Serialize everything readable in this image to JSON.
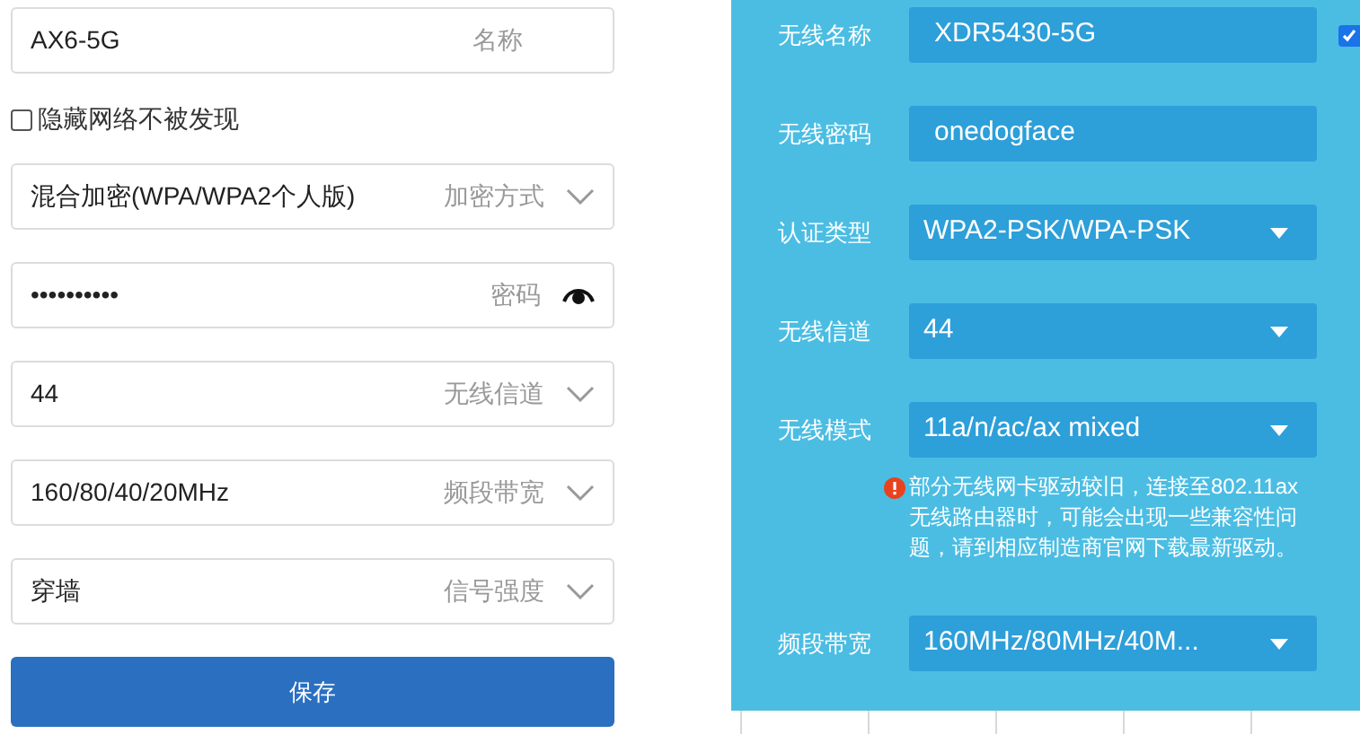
{
  "left_form": {
    "fields": [
      {
        "kind": "text",
        "value": "AX6-5G",
        "label": "名称"
      },
      {
        "kind": "checkbox",
        "text": "隐藏网络不被发现",
        "checked": false
      },
      {
        "kind": "select",
        "value": "混合加密(WPA/WPA2个人版)",
        "label": "加密方式"
      },
      {
        "kind": "password",
        "value": "••••••••••",
        "label": "密码"
      },
      {
        "kind": "select",
        "value": "44",
        "label": "无线信道"
      },
      {
        "kind": "select",
        "value": "160/80/40/20MHz",
        "label": "频段带宽"
      },
      {
        "kind": "select",
        "value": "穿墙",
        "label": "信号强度"
      }
    ],
    "save_button": "保存"
  },
  "right_form": {
    "enable_checkbox": {
      "checked": true
    },
    "fields": [
      {
        "kind": "text",
        "label": "无线名称",
        "value": "XDR5430-5G"
      },
      {
        "kind": "text",
        "label": "无线密码",
        "value": "onedogface"
      },
      {
        "kind": "select",
        "label": "认证类型",
        "value": "WPA2-PSK/WPA-PSK"
      },
      {
        "kind": "select",
        "label": "无线信道",
        "value": "44"
      },
      {
        "kind": "select",
        "label": "无线模式",
        "value": "11a/n/ac/ax mixed",
        "warning": "部分无线网卡驱动较旧，连接至802.11ax无线路由器时，可能会出现一些兼容性问题，请到相应制造商官网下载最新驱动。"
      },
      {
        "kind": "select",
        "label": "频段带宽",
        "value": "160MHz/80MHz/40M..."
      }
    ]
  }
}
